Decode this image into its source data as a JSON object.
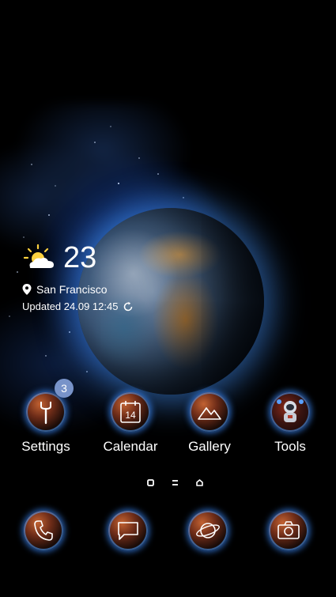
{
  "weather": {
    "temperature": "23",
    "location": "San Francisco",
    "updated": "Updated 24.09 12:45",
    "condition_icon": "partly-sunny-icon"
  },
  "apps": [
    {
      "label": "Settings",
      "icon": "wrench-icon",
      "badge": "3"
    },
    {
      "label": "Calendar",
      "icon": "calendar-icon",
      "date": "14"
    },
    {
      "label": "Gallery",
      "icon": "mountain-image-icon"
    },
    {
      "label": "Tools",
      "icon": "astronaut-icon"
    }
  ],
  "page_indicator": {
    "pages": 3,
    "current": 2
  },
  "dock": [
    {
      "name": "phone",
      "icon": "phone-icon"
    },
    {
      "name": "messages",
      "icon": "message-icon"
    },
    {
      "name": "browser",
      "icon": "planet-browser-icon"
    },
    {
      "name": "camera",
      "icon": "camera-icon"
    }
  ],
  "colors": {
    "glow": "#3c8cff",
    "badge": "#7893c9",
    "text": "#ffffff"
  }
}
